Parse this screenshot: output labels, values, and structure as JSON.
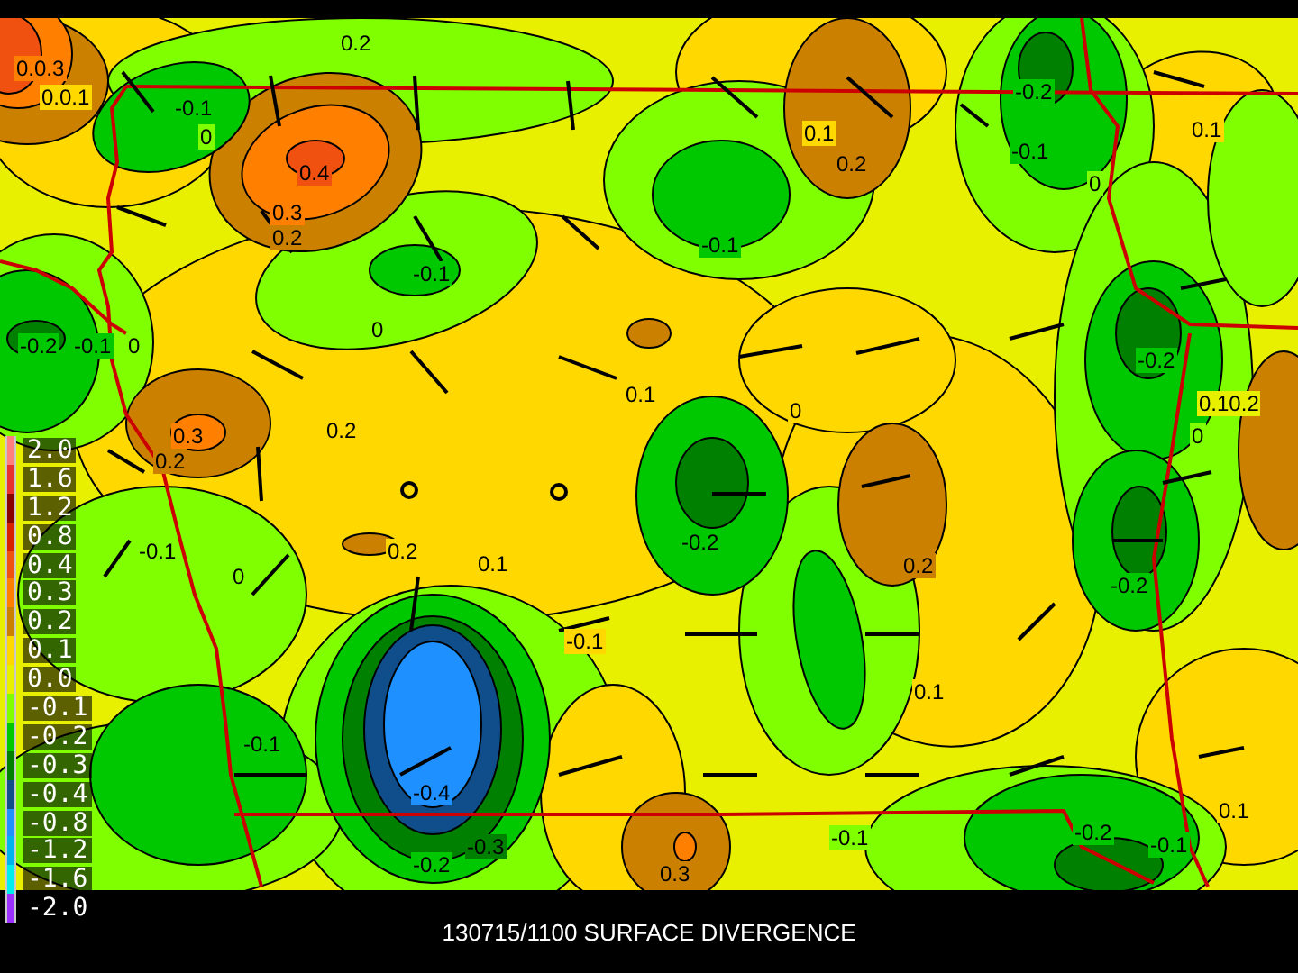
{
  "title": "130715/1100 SURFACE DIVERGENCE",
  "legend": [
    {
      "label": "2.0",
      "color": "#ff7f7f"
    },
    {
      "label": "1.6",
      "color": "#e83030"
    },
    {
      "label": "1.2",
      "color": "#880000"
    },
    {
      "label": "0.8",
      "color": "#d82000"
    },
    {
      "label": "0.4",
      "color": "#f05010"
    },
    {
      "label": "0.3",
      "color": "#ff8000"
    },
    {
      "label": "0.2",
      "color": "#cc8000"
    },
    {
      "label": "0.1",
      "color": "#ffd800"
    },
    {
      "label": "0.0",
      "color": "#e8f000"
    },
    {
      "label": "-0.1",
      "color": "#80ff00"
    },
    {
      "label": "-0.2",
      "color": "#00c800"
    },
    {
      "label": "-0.3",
      "color": "#008000"
    },
    {
      "label": "-0.4",
      "color": "#104e8b"
    },
    {
      "label": "-0.8",
      "color": "#1e90ff"
    },
    {
      "label": "-1.2",
      "color": "#00b2ee"
    },
    {
      "label": "-1.6",
      "color": "#00eeee"
    },
    {
      "label": "-2.0",
      "color": "#9b30ff"
    }
  ],
  "contour_labels": [
    "0.0.3",
    "0.0.1",
    "-0.1",
    "0",
    "0.4",
    "0.3",
    "0.2",
    "-0.1",
    "0",
    "-0.2",
    "-0.1",
    "0",
    "0.3",
    "0.2",
    "0.2",
    "0.1",
    "0.2",
    "0.1",
    "0.2",
    "-0.1",
    "-0.2",
    "-0.1",
    "0",
    "0.1",
    "0",
    "-0.2",
    "0.10.2",
    "0",
    "-0.1",
    "0",
    "0.2",
    "0.1",
    "-0.1",
    "-0.4",
    "-0.3",
    "-0.2",
    "-0.1",
    "-0.2",
    "0.2",
    "-0.2",
    "0.1",
    "0.1",
    "-0.1",
    "-0.2",
    "-0.1",
    "0.3"
  ]
}
